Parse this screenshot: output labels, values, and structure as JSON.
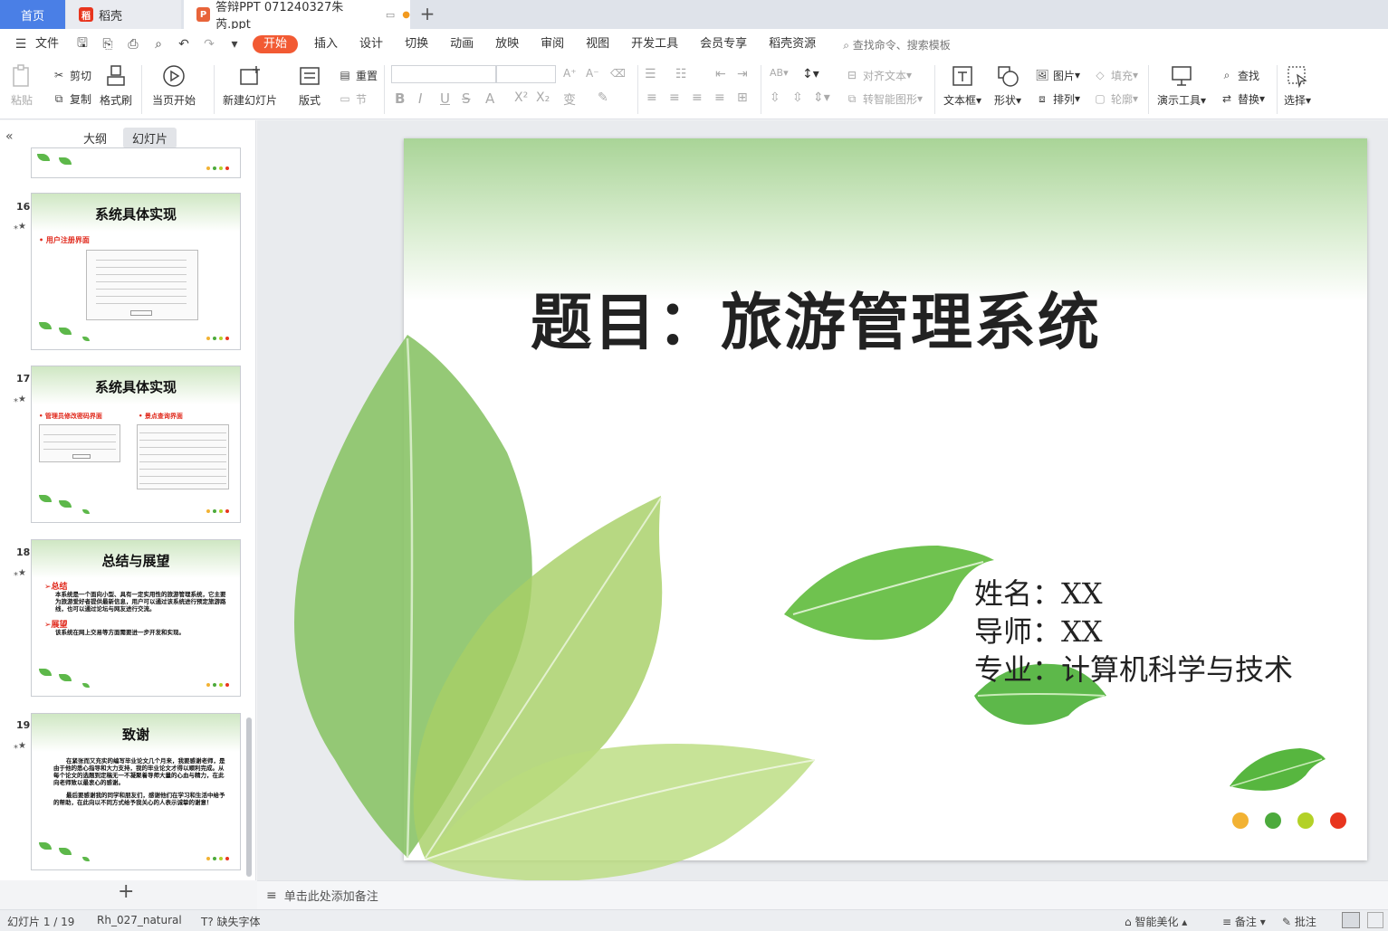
{
  "tabs": {
    "home": "首页",
    "daoke": "稻壳",
    "doc": "答辩PPT 071240327朱芮.ppt",
    "add": "+"
  },
  "menu": {
    "file": "文件",
    "items": [
      "开始",
      "插入",
      "设计",
      "切换",
      "动画",
      "放映",
      "审阅",
      "视图",
      "开发工具",
      "会员专享",
      "稻壳资源"
    ],
    "search": "查找命令、搜索模板"
  },
  "ribbon": {
    "paste": "粘贴",
    "cut": "剪切",
    "copy": "复制",
    "format_painter": "格式刷",
    "from_start": "当页开始",
    "new_slide": "新建幻灯片",
    "layout": "版式",
    "reset": "重置",
    "section": "节",
    "align_text": "对齐文本",
    "smart_shape": "转智能图形",
    "textbox": "文本框",
    "shape": "形状",
    "picture": "图片",
    "arrange": "排列",
    "fill": "填充",
    "outline": "轮廓",
    "present_tools": "演示工具",
    "find": "查找",
    "replace": "替换",
    "select": "选择"
  },
  "panel": {
    "outline_tab": "大纲",
    "slides_tab": "幻灯片",
    "collapse": "«",
    "add": "+"
  },
  "thumbnails": [
    {
      "num": "16",
      "title": "系统具体实现",
      "sub": "用户注册界面"
    },
    {
      "num": "17",
      "title": "系统具体实现",
      "sub_left": "管理员修改密码界面",
      "sub_right": "景点查询界面"
    },
    {
      "num": "18",
      "title": "总结与展望",
      "h1": "总结",
      "p1": "本系统是一个面向小型、具有一定实用性的旅游管理系统，它主要为旅游爱好者提供最新信息，用户可以通过该系统进行预定旅游路线，也可以通过论坛与网友进行交流。",
      "h2": "展望",
      "p2": "该系统在网上交易等方面需要进一步开发和实现。"
    },
    {
      "num": "19",
      "title": "致谢",
      "p1": "在紧张而又充实的编写毕业论文几个月来，我要感谢老师，是由于他的悉心指导和大力支持，我的毕业论文才得以顺利完成。从每个论文的选题到定稿无一不凝聚着导师大量的心血与精力，在此向老师致以最衷心的感谢。",
      "p2": "最后要感谢我的同学和朋友们，感谢他们在学习和生活中给予的帮助，在此向以不同方式给予我关心的人表示诚挚的谢意！"
    }
  ],
  "slide": {
    "title": "题目：旅游管理系统",
    "name_line": "姓名：XX",
    "tutor_line": "导师：XX",
    "major_line": "专业：计算机科学与技术",
    "dot_colors": [
      "#f2b233",
      "#4caa3c",
      "#b3d127",
      "#e8351e"
    ]
  },
  "notes": "单击此处添加备注",
  "status": {
    "slide_count": "幻灯片 1 / 19",
    "theme": "Rh_027_natural",
    "missing_font": "缺失字体",
    "beautify": "智能美化",
    "notes_btn": "备注",
    "comment_btn": "批注"
  },
  "colors": {
    "accent": "#f25a33",
    "home_tab": "#4a7fe6"
  }
}
